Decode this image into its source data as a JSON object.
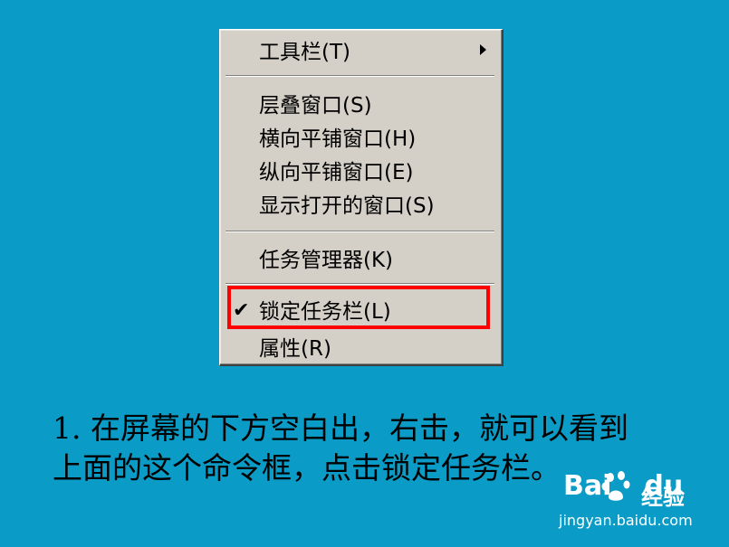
{
  "context_menu": {
    "items": [
      {
        "label": "工具栏(T)",
        "has_submenu": true,
        "checked": false
      },
      {
        "label": "层叠窗口(S)",
        "has_submenu": false,
        "checked": false
      },
      {
        "label": "横向平铺窗口(H)",
        "has_submenu": false,
        "checked": false
      },
      {
        "label": "纵向平铺窗口(E)",
        "has_submenu": false,
        "checked": false
      },
      {
        "label": "显示打开的窗口(S)",
        "has_submenu": false,
        "checked": false
      },
      {
        "label": "任务管理器(K)",
        "has_submenu": false,
        "checked": false
      },
      {
        "label": "锁定任务栏(L)",
        "has_submenu": false,
        "checked": true,
        "highlighted": true
      },
      {
        "label": "属性(R)",
        "has_submenu": false,
        "checked": false
      }
    ],
    "check_glyph": "✔"
  },
  "caption": {
    "line1": "1. 在屏幕的下方空白出，右击，就可以看到",
    "line2": "上面的这个命令框，点击锁定任务栏。"
  },
  "watermark": {
    "logo": "Bai",
    "logo_suffix": "du",
    "brand": "经验",
    "url": "jingyan.baidu.com"
  },
  "colors": {
    "background": "#0a9bc6",
    "menu_face": "#d4d0c8",
    "highlight_border": "#ff0000"
  }
}
